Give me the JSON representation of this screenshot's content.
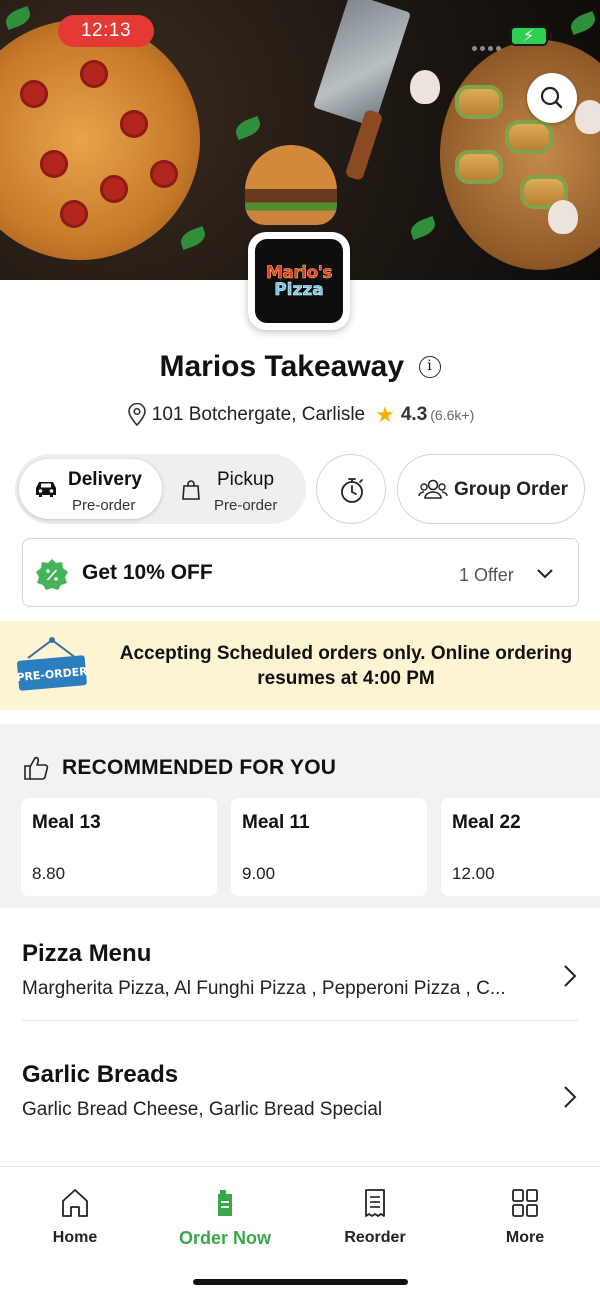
{
  "status_bar": {
    "time": "12:13"
  },
  "colors": {
    "accent_green": "#3aa84a",
    "time_pill": "#e53935",
    "star": "#f5b400",
    "banner_bg": "#fdf4d4"
  },
  "restaurant": {
    "logo_line1": "Mario's",
    "logo_line2": "Pizza",
    "name": "Marios Takeaway",
    "address": "101 Botchergate, Carlisle",
    "rating": "4.3",
    "rating_count": "(6.6k+)"
  },
  "order_modes": {
    "delivery": {
      "label": "Delivery",
      "sub": "Pre-order"
    },
    "pickup": {
      "label": "Pickup",
      "sub": "Pre-order"
    },
    "group_order_label": "Group Order"
  },
  "offer": {
    "title": "Get 10% OFF",
    "count": "1 Offer"
  },
  "banner": {
    "sign_text": "PRE-ORDER",
    "message": "Accepting Scheduled orders only. Online ordering resumes at 4:00 PM"
  },
  "recommended": {
    "heading": "RECOMMENDED FOR YOU",
    "items": [
      {
        "name": "Meal 13",
        "price": "8.80"
      },
      {
        "name": "Meal 11",
        "price": "9.00"
      },
      {
        "name": "Meal 22",
        "price": "12.00"
      }
    ]
  },
  "menu": [
    {
      "title": "Pizza Menu",
      "desc": "Margherita Pizza, Al Funghi Pizza , Pepperoni Pizza , C..."
    },
    {
      "title": "Garlic Breads",
      "desc": "Garlic Bread Cheese, Garlic Bread Special"
    }
  ],
  "tabbar": [
    {
      "label": "Home",
      "icon": "home-icon"
    },
    {
      "label": "Order Now",
      "icon": "order-bag-icon"
    },
    {
      "label": "Reorder",
      "icon": "receipt-icon"
    },
    {
      "label": "More",
      "icon": "grid-icon"
    }
  ]
}
